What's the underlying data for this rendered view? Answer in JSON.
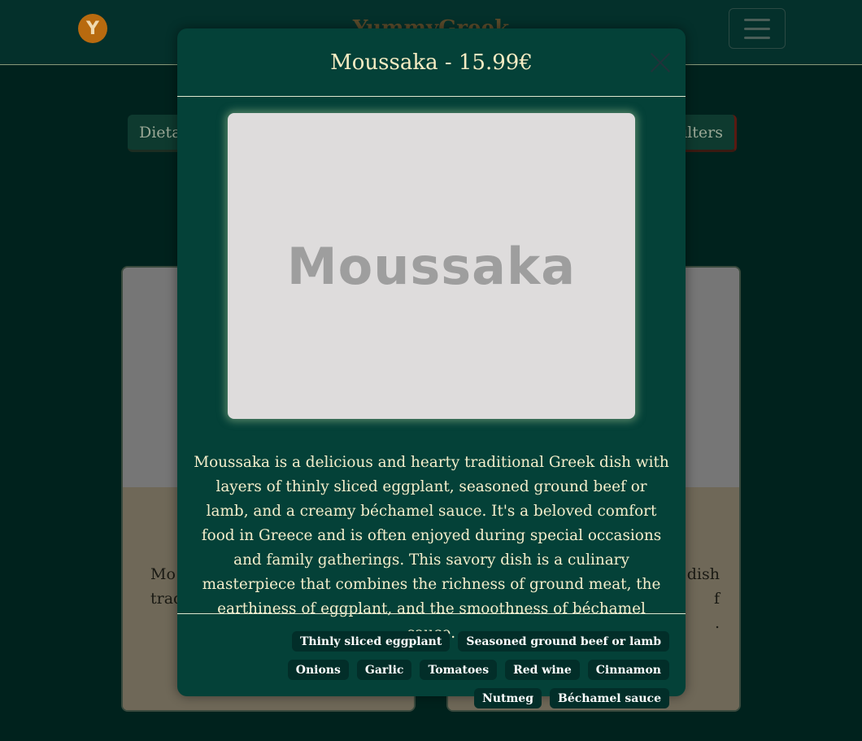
{
  "navbar": {
    "logo_letter": "Y",
    "brand": "YummyGreek"
  },
  "filters": {
    "left_label": "Dietar",
    "right_label": "Filters"
  },
  "cards": [
    {
      "text": "Mo\ntrad"
    },
    {
      "text": "t dish\nf\n."
    }
  ],
  "modal": {
    "title": "Moussaka - 15.99€",
    "image_text": "Moussaka",
    "description": "Moussaka is a delicious and hearty traditional Greek dish with layers of thinly sliced eggplant, seasoned ground beef or lamb, and a creamy béchamel sauce. It's a beloved comfort food in Greece and is often enjoyed during special occasions and family gatherings. This savory dish is a culinary masterpiece that combines the richness of ground meat, the earthiness of eggplant, and the smoothness of béchamel sauce.",
    "ingredients": [
      "Thinly sliced eggplant",
      "Seasoned ground beef or lamb",
      "Onions",
      "Garlic",
      "Tomatoes",
      "Red wine",
      "Cinnamon",
      "Nutmeg",
      "Béchamel sauce"
    ]
  }
}
